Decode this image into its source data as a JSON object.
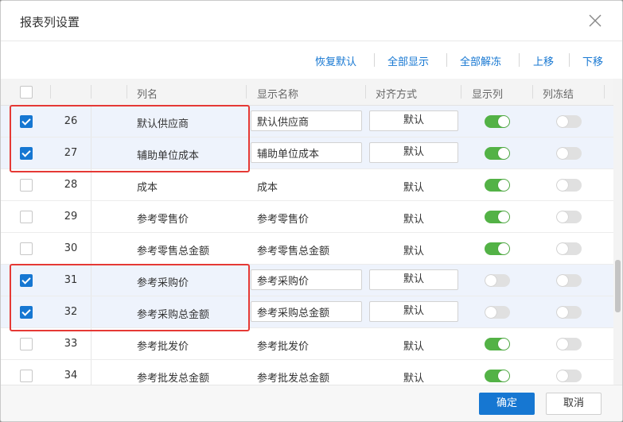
{
  "dialog": {
    "title": "报表列设置"
  },
  "toolbar": {
    "restore_default": "恢复默认",
    "show_all": "全部显示",
    "unfreeze_all": "全部解冻",
    "move_up": "上移",
    "move_down": "下移"
  },
  "table": {
    "headers": {
      "name": "列名",
      "display_name": "显示名称",
      "align": "对齐方式",
      "show": "显示列",
      "freeze": "列冻结"
    },
    "rows": [
      {
        "num": "26",
        "name": "默认供应商",
        "display": "默认供应商",
        "align": "默认",
        "checked": true,
        "show": true,
        "freeze": false,
        "editing": true
      },
      {
        "num": "27",
        "name": "辅助单位成本",
        "display": "辅助单位成本",
        "align": "默认",
        "checked": true,
        "show": true,
        "freeze": false,
        "editing": true
      },
      {
        "num": "28",
        "name": "成本",
        "display": "成本",
        "align": "默认",
        "checked": false,
        "show": true,
        "freeze": false,
        "editing": false
      },
      {
        "num": "29",
        "name": "参考零售价",
        "display": "参考零售价",
        "align": "默认",
        "checked": false,
        "show": true,
        "freeze": false,
        "editing": false
      },
      {
        "num": "30",
        "name": "参考零售总金额",
        "display": "参考零售总金额",
        "align": "默认",
        "checked": false,
        "show": true,
        "freeze": false,
        "editing": false
      },
      {
        "num": "31",
        "name": "参考采购价",
        "display": "参考采购价",
        "align": "默认",
        "checked": true,
        "show": false,
        "freeze": false,
        "editing": true
      },
      {
        "num": "32",
        "name": "参考采购总金额",
        "display": "参考采购总金额",
        "align": "默认",
        "checked": true,
        "show": false,
        "freeze": false,
        "editing": true
      },
      {
        "num": "33",
        "name": "参考批发价",
        "display": "参考批发价",
        "align": "默认",
        "checked": false,
        "show": true,
        "freeze": false,
        "editing": false
      },
      {
        "num": "34",
        "name": "参考批发总金额",
        "display": "参考批发总金额",
        "align": "默认",
        "checked": false,
        "show": true,
        "freeze": false,
        "editing": false
      }
    ]
  },
  "footer": {
    "confirm": "确定",
    "cancel": "取消"
  },
  "colors": {
    "accent": "#1677d2",
    "toggle_on": "#53b246",
    "highlight": "#e53935",
    "selected_row": "#eef3fc"
  },
  "icons": {
    "close": "close-icon",
    "checkbox_checked": "checkmark-icon"
  }
}
